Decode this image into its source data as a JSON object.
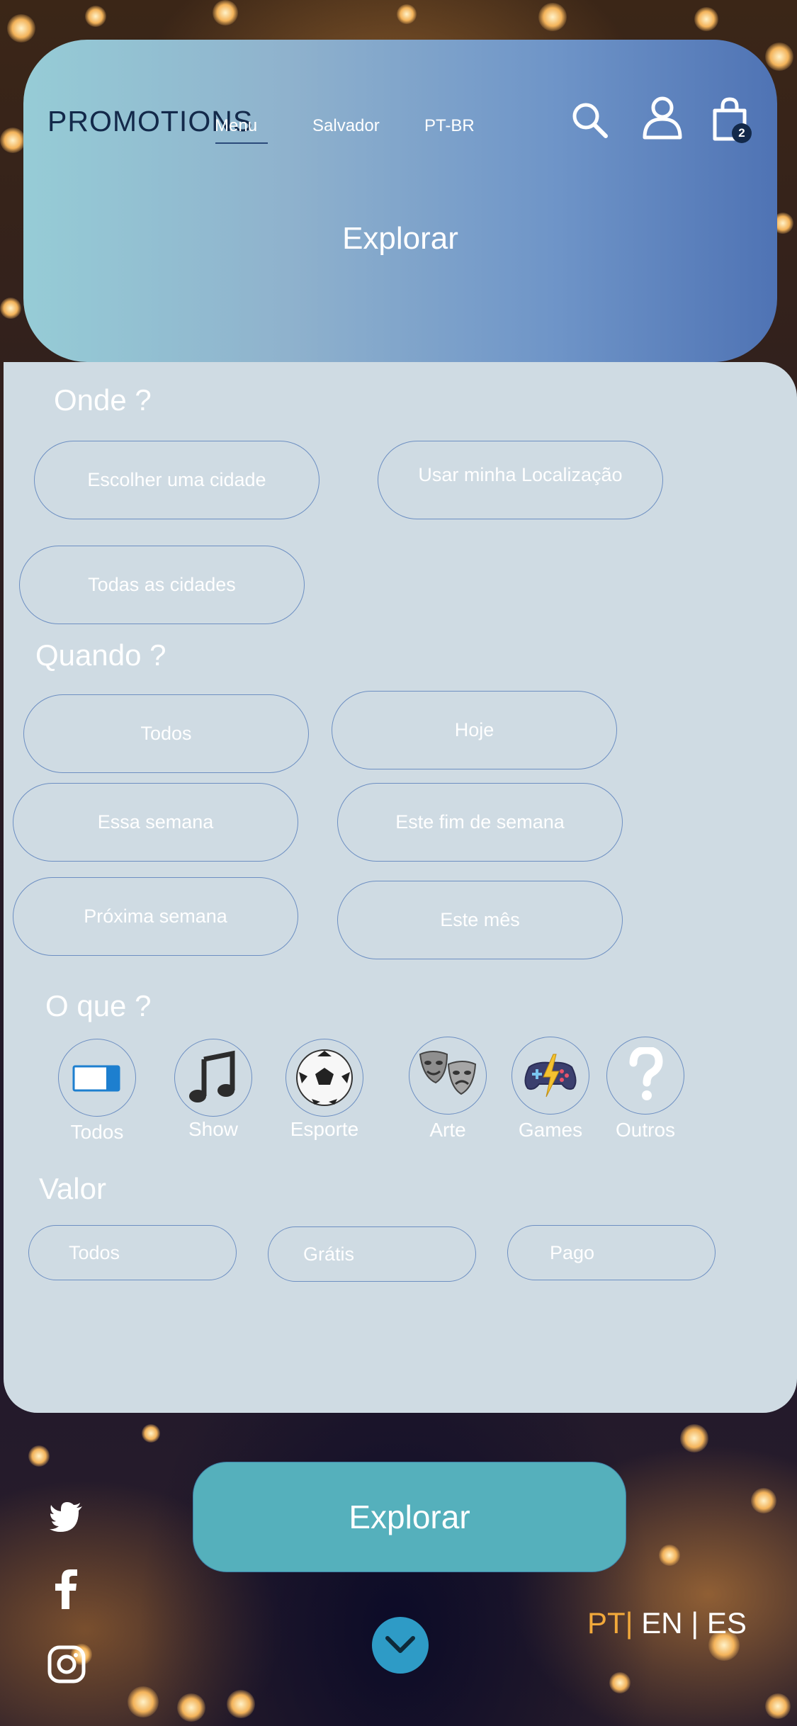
{
  "header": {
    "brand": "PROMOTIONS",
    "nav": {
      "menu": "Menu",
      "city": "Salvador",
      "language": "PT-BR"
    },
    "cart_count": "2",
    "title": "Explorar",
    "icons": [
      "search-icon",
      "user-icon",
      "shopping-bag-icon"
    ]
  },
  "where": {
    "title": "Onde ?",
    "options": [
      "Escolher uma cidade",
      "Usar minha Localização",
      "Todas as cidades"
    ]
  },
  "when": {
    "title": "Quando ?",
    "options": [
      "Todos",
      "Hoje",
      "Essa semana",
      "Este fim de semana",
      "Próxima semana",
      "Este mês"
    ]
  },
  "what": {
    "title": "O que ?",
    "categories": [
      {
        "label": "Todos",
        "icon": "toggle-icon"
      },
      {
        "label": "Show",
        "icon": "music-note-icon"
      },
      {
        "label": "Esporte",
        "icon": "soccer-ball-icon"
      },
      {
        "label": "Arte",
        "icon": "theater-masks-icon"
      },
      {
        "label": "Games",
        "icon": "gamepad-icon"
      },
      {
        "label": "Outros",
        "icon": "question-mark-icon"
      }
    ]
  },
  "price": {
    "title": "Valor",
    "options": [
      "Todos",
      "Grátis",
      "Pago"
    ]
  },
  "footer": {
    "explore_button": "Explorar",
    "social": [
      "twitter-icon",
      "facebook-icon",
      "instagram-icon"
    ],
    "languages": [
      "PT",
      "EN",
      "ES"
    ],
    "active_language": "PT"
  },
  "colors": {
    "header_gradient": [
      "#96ccd6",
      "#4f73b4"
    ],
    "panel": "#cfdbe3",
    "pill_border": "#6d8fc2",
    "explore_button": "#55b0bc",
    "active_language": "#f2a93b",
    "brand_text": "#13294a"
  }
}
